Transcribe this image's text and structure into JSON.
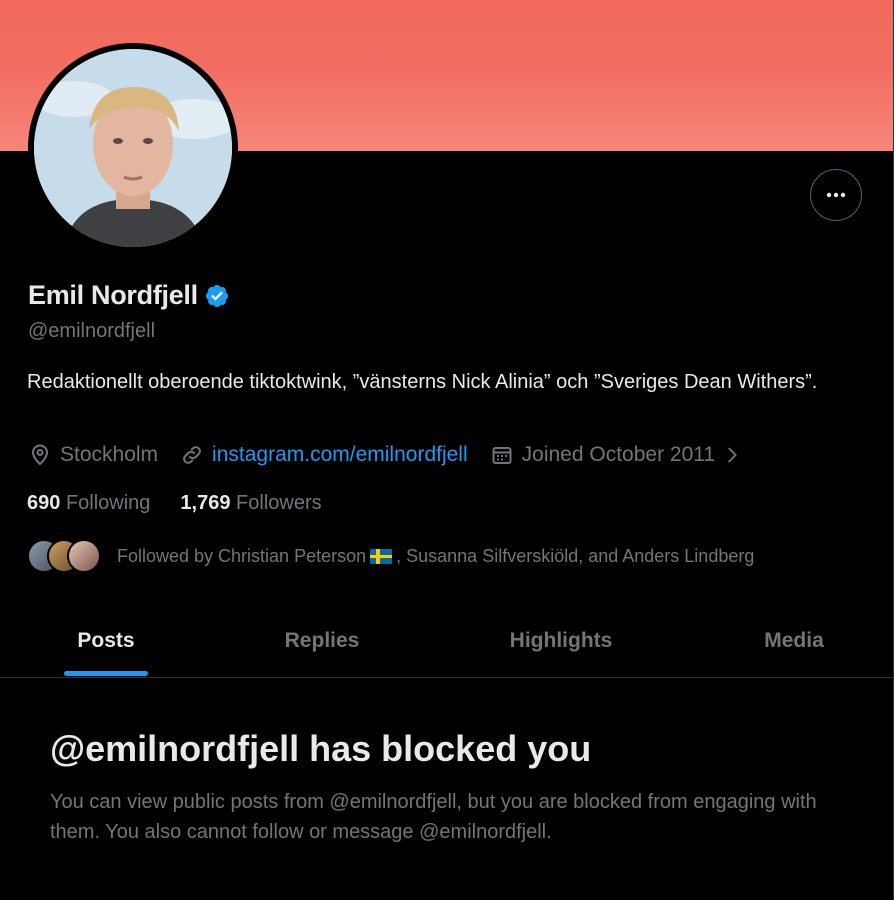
{
  "profile": {
    "name": "Emil Nordfjell",
    "handle": "@emilnordfjell",
    "bio": "Redaktionellt oberoende tiktoktwink, ”vänsterns Nick Alinia”  och ”Sveriges Dean Withers”.",
    "location": "Stockholm",
    "website": "instagram.com/emilnordfjell",
    "joined": "Joined October 2011",
    "following_count": "690",
    "following_label": "Following",
    "followers_count": "1,769",
    "followers_label": "Followers",
    "followed_by_prefix": "Followed by Christian Peterson",
    "followed_by_suffix": ", Susanna Silfverskiöld, and Anders Lindberg"
  },
  "tabs": [
    {
      "label": "Posts",
      "active": true
    },
    {
      "label": "Replies",
      "active": false
    },
    {
      "label": "Highlights",
      "active": false
    },
    {
      "label": "Media",
      "active": false
    }
  ],
  "blocked": {
    "title": "@emilnordfjell has blocked you",
    "message": "You can view public posts from @emilnordfjell, but you are blocked from engaging with them. You also cannot follow or message @emilnordfjell."
  },
  "icons": {
    "more": "more-horizontal-icon",
    "verified": "verified-badge-icon",
    "location": "location-pin-icon",
    "link": "link-icon",
    "calendar": "calendar-icon",
    "chevron": "chevron-right-icon"
  },
  "colors": {
    "accent": "#1d9bf0",
    "banner": "#f26a5e",
    "background": "#000000",
    "secondary_text": "#71767b"
  }
}
